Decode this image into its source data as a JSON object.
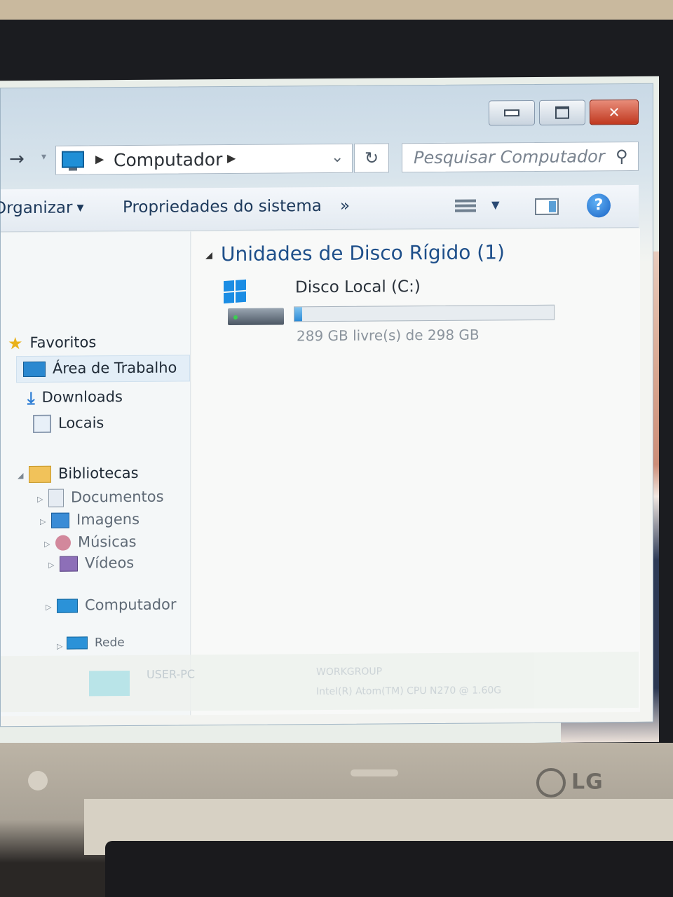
{
  "explorer": {
    "address": {
      "crumb": "Computador"
    },
    "search": {
      "placeholder": "Pesquisar Computador"
    },
    "toolbar": {
      "organize": "Organizar",
      "system_properties": "Propriedades do sistema",
      "more": "»"
    },
    "sidebar": {
      "favorites": "Favoritos",
      "desktop": "Área de Trabalho",
      "downloads": "Downloads",
      "places": "Locais",
      "libraries": "Bibliotecas",
      "documents": "Documentos",
      "pictures": "Imagens",
      "music": "Músicas",
      "videos": "Vídeos",
      "computer": "Computador",
      "network": "Rede"
    },
    "content": {
      "group_header": "Unidades de Disco Rígido (1)",
      "drive": {
        "name": "Disco Local (C:)",
        "free_text": "289 GB livre(s) de 298 GB",
        "used_fraction": 0.03
      }
    },
    "details": {
      "computer_name": "USER-PC",
      "workgroup": "WORKGROUP",
      "processor": "Intel(R) Atom(TM) CPU N270 @ 1.60G"
    }
  },
  "device": {
    "brand": "LG"
  },
  "colors": {
    "accent": "#1e4f8a",
    "capacity_fill": "#2b8ad6",
    "close_button": "#c0381f"
  }
}
